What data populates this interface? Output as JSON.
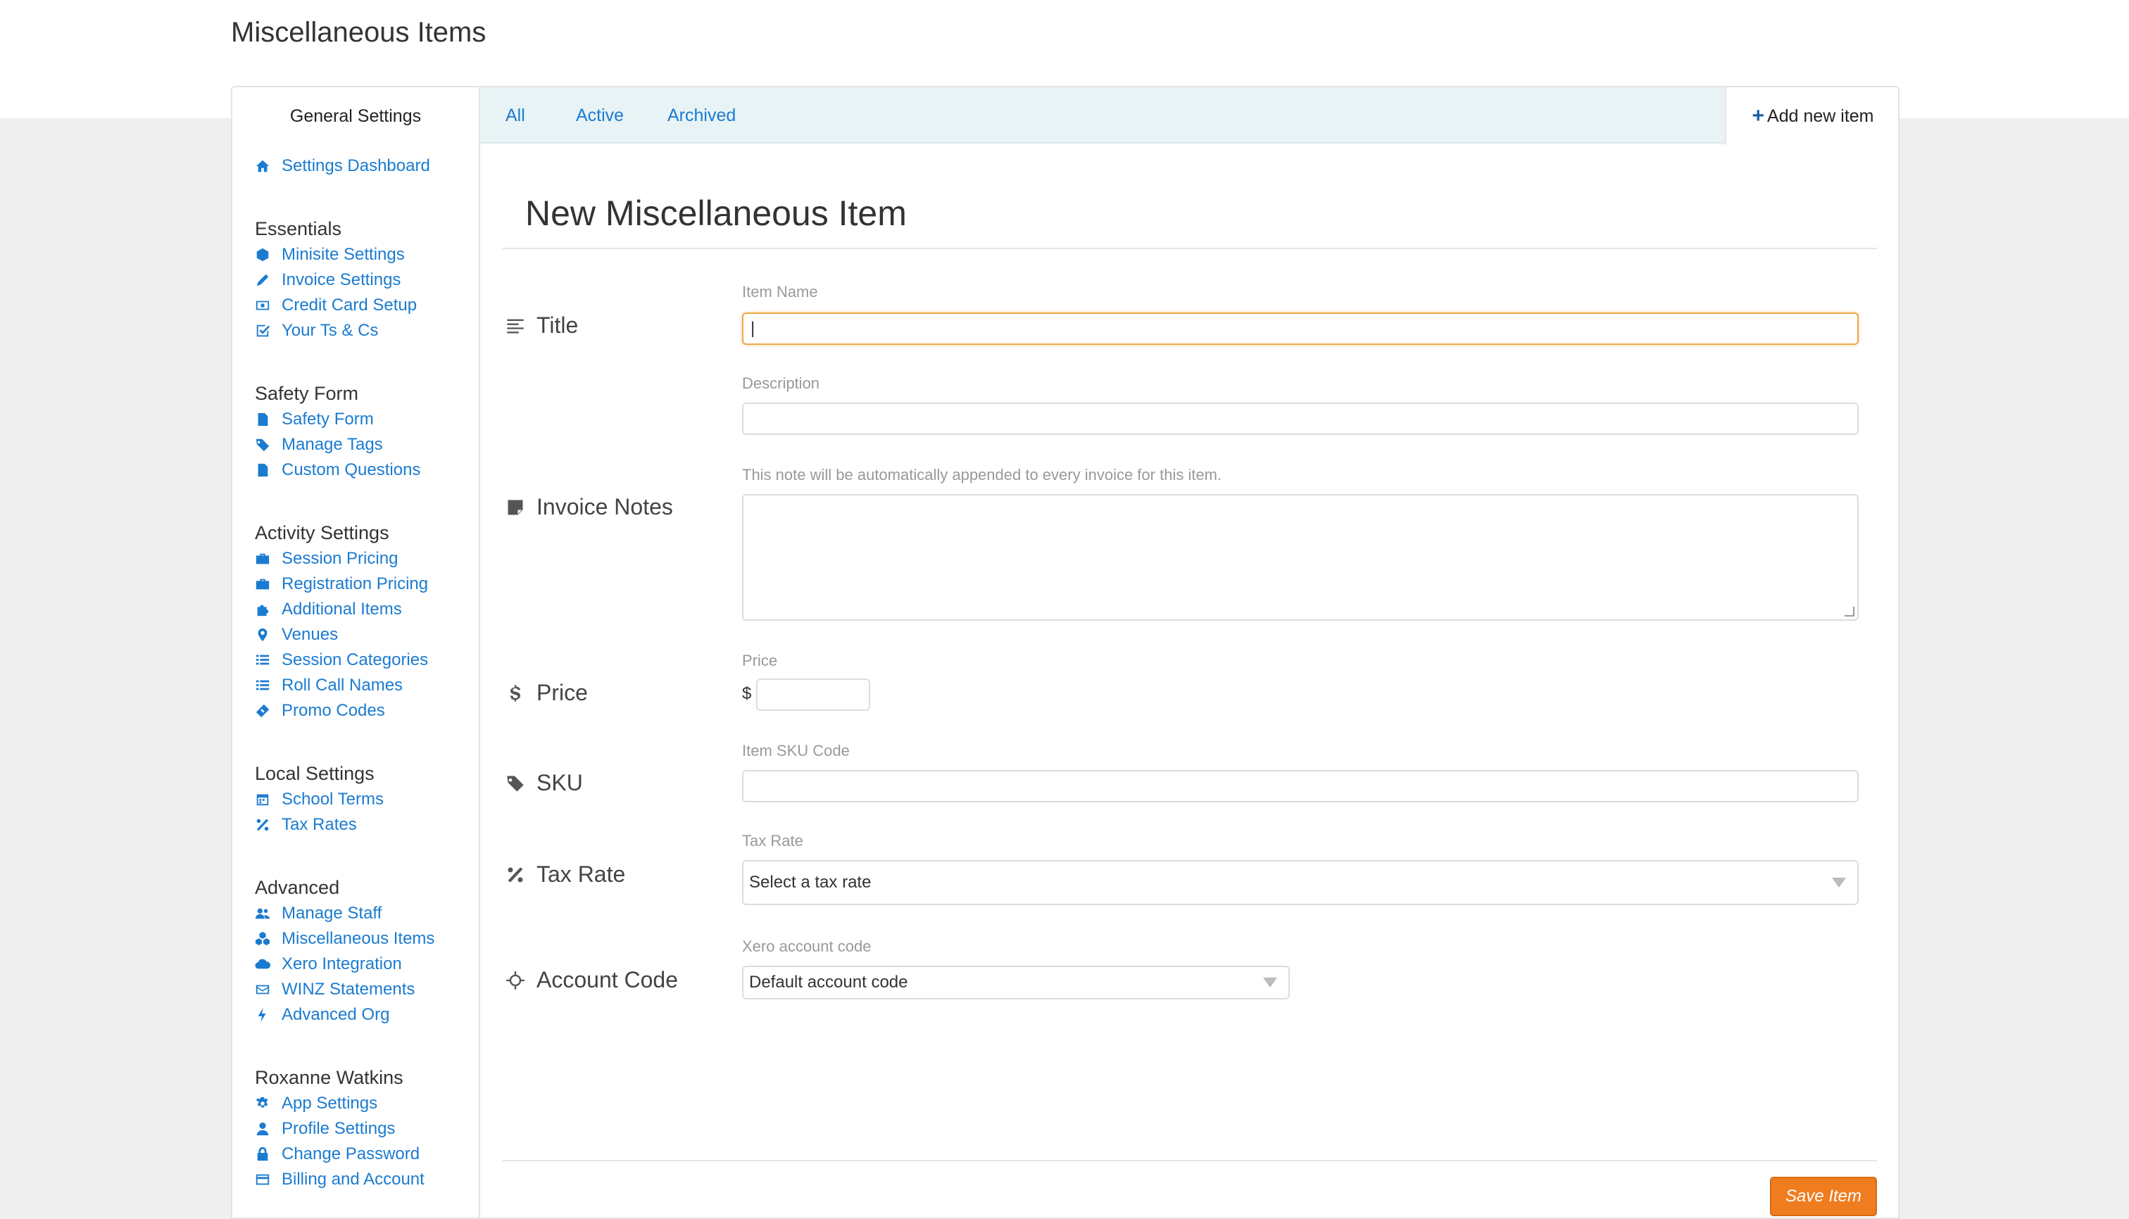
{
  "page": {
    "title": "Miscellaneous Items"
  },
  "sidebar": {
    "header": "General Settings",
    "dashboard": {
      "label": "Settings Dashboard",
      "icon": "home-icon"
    },
    "sections": [
      {
        "title": "Essentials",
        "items": [
          {
            "label": "Minisite Settings",
            "icon": "cube-icon"
          },
          {
            "label": "Invoice Settings",
            "icon": "pencil-icon"
          },
          {
            "label": "Credit Card Setup",
            "icon": "money-icon"
          },
          {
            "label": "Your Ts & Cs",
            "icon": "check-square-icon"
          }
        ]
      },
      {
        "title": "Safety Form",
        "items": [
          {
            "label": "Safety Form",
            "icon": "file-icon"
          },
          {
            "label": "Manage Tags",
            "icon": "tags-icon"
          },
          {
            "label": "Custom Questions",
            "icon": "file-icon"
          }
        ]
      },
      {
        "title": "Activity Settings",
        "items": [
          {
            "label": "Session Pricing",
            "icon": "briefcase-icon"
          },
          {
            "label": "Registration Pricing",
            "icon": "briefcase-icon"
          },
          {
            "label": "Additional Items",
            "icon": "puzzle-icon"
          },
          {
            "label": "Venues",
            "icon": "map-marker-icon"
          },
          {
            "label": "Session Categories",
            "icon": "list-icon"
          },
          {
            "label": "Roll Call Names",
            "icon": "list-icon"
          },
          {
            "label": "Promo Codes",
            "icon": "ticket-icon"
          }
        ]
      },
      {
        "title": "Local Settings",
        "items": [
          {
            "label": "School Terms",
            "icon": "calendar-icon"
          },
          {
            "label": "Tax Rates",
            "icon": "percent-icon"
          }
        ]
      },
      {
        "title": "Advanced",
        "items": [
          {
            "label": "Manage Staff",
            "icon": "users-icon"
          },
          {
            "label": "Miscellaneous Items",
            "icon": "cubes-icon"
          },
          {
            "label": "Xero Integration",
            "icon": "cloud-icon"
          },
          {
            "label": "WINZ Statements",
            "icon": "envelope-icon"
          },
          {
            "label": "Advanced Org",
            "icon": "bolt-icon"
          }
        ]
      },
      {
        "title": "Roxanne Watkins",
        "items": [
          {
            "label": "App Settings",
            "icon": "cog-icon"
          },
          {
            "label": "Profile Settings",
            "icon": "user-icon"
          },
          {
            "label": "Change Password",
            "icon": "lock-icon"
          },
          {
            "label": "Billing and Account",
            "icon": "credit-card-icon"
          }
        ]
      }
    ]
  },
  "tabs": [
    "All",
    "Active",
    "Archived"
  ],
  "add_new": {
    "label": "Add new item",
    "icon": "plus-icon"
  },
  "form": {
    "title": "New Miscellaneous Item",
    "rows": {
      "title": {
        "label": "Title",
        "icon": "align-left-icon"
      },
      "invoice_notes": {
        "label": "Invoice Notes",
        "icon": "sticky-note-icon"
      },
      "price": {
        "label": "Price",
        "icon": "dollar-icon"
      },
      "sku": {
        "label": "SKU",
        "icon": "tag-icon"
      },
      "tax_rate": {
        "label": "Tax Rate",
        "icon": "percent-icon"
      },
      "account_code": {
        "label": "Account Code",
        "icon": "crosshairs-icon"
      }
    },
    "fields": {
      "item_name": {
        "label": "Item Name",
        "value": "|"
      },
      "description": {
        "label": "Description",
        "value": ""
      },
      "invoice_note": {
        "label": "This note will be automatically appended to every invoice for this item.",
        "value": ""
      },
      "price": {
        "label": "Price",
        "currency": "$",
        "value": ""
      },
      "sku": {
        "label": "Item SKU Code",
        "value": ""
      },
      "tax_rate": {
        "label": "Tax Rate",
        "selected": "Select a tax rate"
      },
      "account_code": {
        "label": "Xero account code",
        "selected": "Default account code"
      }
    },
    "save_label": "Save Item"
  },
  "colors": {
    "link": "#1b7bd0",
    "tabs_bg": "#e7f3f5",
    "save_button": "#ef7d1f",
    "focus_border": "#f0a94a"
  }
}
